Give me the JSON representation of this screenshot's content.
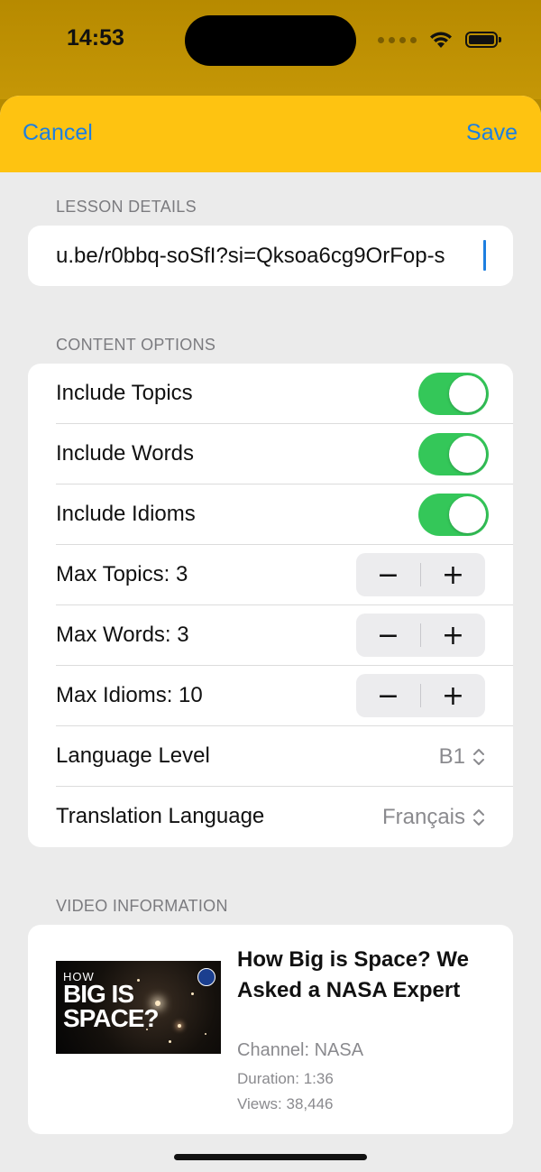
{
  "status_bar": {
    "time": "14:53",
    "icons": [
      "cellular-dots-icon",
      "wifi-icon",
      "battery-icon"
    ]
  },
  "nav": {
    "cancel_label": "Cancel",
    "save_label": "Save"
  },
  "lesson_details": {
    "header": "LESSON DETAILS",
    "url_value": "u.be/r0bbq-soSfI?si=Qksoa6cg9OrFop-s"
  },
  "content_options": {
    "header": "CONTENT OPTIONS",
    "toggles": [
      {
        "label": "Include Topics",
        "on": true
      },
      {
        "label": "Include Words",
        "on": true
      },
      {
        "label": "Include Idioms",
        "on": true
      }
    ],
    "steppers": [
      {
        "label": "Max Topics: 3",
        "value": 3
      },
      {
        "label": "Max Words: 3",
        "value": 3
      },
      {
        "label": "Max Idioms: 10",
        "value": 10
      }
    ],
    "stepper_minus": "−",
    "stepper_plus": "+",
    "pickers": [
      {
        "label": "Language Level",
        "value": "B1"
      },
      {
        "label": "Translation Language",
        "value": "Français"
      }
    ]
  },
  "video_information": {
    "header": "VIDEO INFORMATION",
    "thumbnail_text_small": "HOW",
    "thumbnail_text_big_1": "BIG IS",
    "thumbnail_text_big_2": "SPACE?",
    "title": "How Big is Space? We Asked a NASA Expert",
    "channel": "Channel: NASA",
    "duration": "Duration: 1:36",
    "views": "Views: 38,446"
  },
  "colors": {
    "accent": "#1d7fe0",
    "nav_bar": "#fec311",
    "toggle_on": "#34c759"
  }
}
